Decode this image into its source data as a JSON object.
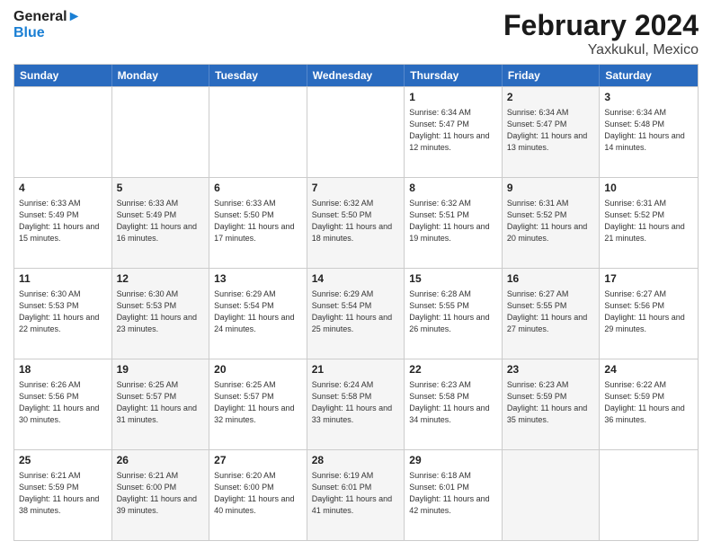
{
  "header": {
    "logo_general": "General",
    "logo_blue": "Blue",
    "title": "February 2024",
    "subtitle": "Yaxkukul, Mexico"
  },
  "days": [
    "Sunday",
    "Monday",
    "Tuesday",
    "Wednesday",
    "Thursday",
    "Friday",
    "Saturday"
  ],
  "rows": [
    [
      {
        "day": "",
        "info": "",
        "shaded": false
      },
      {
        "day": "",
        "info": "",
        "shaded": false
      },
      {
        "day": "",
        "info": "",
        "shaded": false
      },
      {
        "day": "",
        "info": "",
        "shaded": false
      },
      {
        "day": "1",
        "info": "Sunrise: 6:34 AM\nSunset: 5:47 PM\nDaylight: 11 hours\nand 12 minutes.",
        "shaded": false
      },
      {
        "day": "2",
        "info": "Sunrise: 6:34 AM\nSunset: 5:47 PM\nDaylight: 11 hours\nand 13 minutes.",
        "shaded": true
      },
      {
        "day": "3",
        "info": "Sunrise: 6:34 AM\nSunset: 5:48 PM\nDaylight: 11 hours\nand 14 minutes.",
        "shaded": false
      }
    ],
    [
      {
        "day": "4",
        "info": "Sunrise: 6:33 AM\nSunset: 5:49 PM\nDaylight: 11 hours\nand 15 minutes.",
        "shaded": false
      },
      {
        "day": "5",
        "info": "Sunrise: 6:33 AM\nSunset: 5:49 PM\nDaylight: 11 hours\nand 16 minutes.",
        "shaded": true
      },
      {
        "day": "6",
        "info": "Sunrise: 6:33 AM\nSunset: 5:50 PM\nDaylight: 11 hours\nand 17 minutes.",
        "shaded": false
      },
      {
        "day": "7",
        "info": "Sunrise: 6:32 AM\nSunset: 5:50 PM\nDaylight: 11 hours\nand 18 minutes.",
        "shaded": true
      },
      {
        "day": "8",
        "info": "Sunrise: 6:32 AM\nSunset: 5:51 PM\nDaylight: 11 hours\nand 19 minutes.",
        "shaded": false
      },
      {
        "day": "9",
        "info": "Sunrise: 6:31 AM\nSunset: 5:52 PM\nDaylight: 11 hours\nand 20 minutes.",
        "shaded": true
      },
      {
        "day": "10",
        "info": "Sunrise: 6:31 AM\nSunset: 5:52 PM\nDaylight: 11 hours\nand 21 minutes.",
        "shaded": false
      }
    ],
    [
      {
        "day": "11",
        "info": "Sunrise: 6:30 AM\nSunset: 5:53 PM\nDaylight: 11 hours\nand 22 minutes.",
        "shaded": false
      },
      {
        "day": "12",
        "info": "Sunrise: 6:30 AM\nSunset: 5:53 PM\nDaylight: 11 hours\nand 23 minutes.",
        "shaded": true
      },
      {
        "day": "13",
        "info": "Sunrise: 6:29 AM\nSunset: 5:54 PM\nDaylight: 11 hours\nand 24 minutes.",
        "shaded": false
      },
      {
        "day": "14",
        "info": "Sunrise: 6:29 AM\nSunset: 5:54 PM\nDaylight: 11 hours\nand 25 minutes.",
        "shaded": true
      },
      {
        "day": "15",
        "info": "Sunrise: 6:28 AM\nSunset: 5:55 PM\nDaylight: 11 hours\nand 26 minutes.",
        "shaded": false
      },
      {
        "day": "16",
        "info": "Sunrise: 6:27 AM\nSunset: 5:55 PM\nDaylight: 11 hours\nand 27 minutes.",
        "shaded": true
      },
      {
        "day": "17",
        "info": "Sunrise: 6:27 AM\nSunset: 5:56 PM\nDaylight: 11 hours\nand 29 minutes.",
        "shaded": false
      }
    ],
    [
      {
        "day": "18",
        "info": "Sunrise: 6:26 AM\nSunset: 5:56 PM\nDaylight: 11 hours\nand 30 minutes.",
        "shaded": false
      },
      {
        "day": "19",
        "info": "Sunrise: 6:25 AM\nSunset: 5:57 PM\nDaylight: 11 hours\nand 31 minutes.",
        "shaded": true
      },
      {
        "day": "20",
        "info": "Sunrise: 6:25 AM\nSunset: 5:57 PM\nDaylight: 11 hours\nand 32 minutes.",
        "shaded": false
      },
      {
        "day": "21",
        "info": "Sunrise: 6:24 AM\nSunset: 5:58 PM\nDaylight: 11 hours\nand 33 minutes.",
        "shaded": true
      },
      {
        "day": "22",
        "info": "Sunrise: 6:23 AM\nSunset: 5:58 PM\nDaylight: 11 hours\nand 34 minutes.",
        "shaded": false
      },
      {
        "day": "23",
        "info": "Sunrise: 6:23 AM\nSunset: 5:59 PM\nDaylight: 11 hours\nand 35 minutes.",
        "shaded": true
      },
      {
        "day": "24",
        "info": "Sunrise: 6:22 AM\nSunset: 5:59 PM\nDaylight: 11 hours\nand 36 minutes.",
        "shaded": false
      }
    ],
    [
      {
        "day": "25",
        "info": "Sunrise: 6:21 AM\nSunset: 5:59 PM\nDaylight: 11 hours\nand 38 minutes.",
        "shaded": false
      },
      {
        "day": "26",
        "info": "Sunrise: 6:21 AM\nSunset: 6:00 PM\nDaylight: 11 hours\nand 39 minutes.",
        "shaded": true
      },
      {
        "day": "27",
        "info": "Sunrise: 6:20 AM\nSunset: 6:00 PM\nDaylight: 11 hours\nand 40 minutes.",
        "shaded": false
      },
      {
        "day": "28",
        "info": "Sunrise: 6:19 AM\nSunset: 6:01 PM\nDaylight: 11 hours\nand 41 minutes.",
        "shaded": true
      },
      {
        "day": "29",
        "info": "Sunrise: 6:18 AM\nSunset: 6:01 PM\nDaylight: 11 hours\nand 42 minutes.",
        "shaded": false
      },
      {
        "day": "",
        "info": "",
        "shaded": true
      },
      {
        "day": "",
        "info": "",
        "shaded": false
      }
    ]
  ]
}
